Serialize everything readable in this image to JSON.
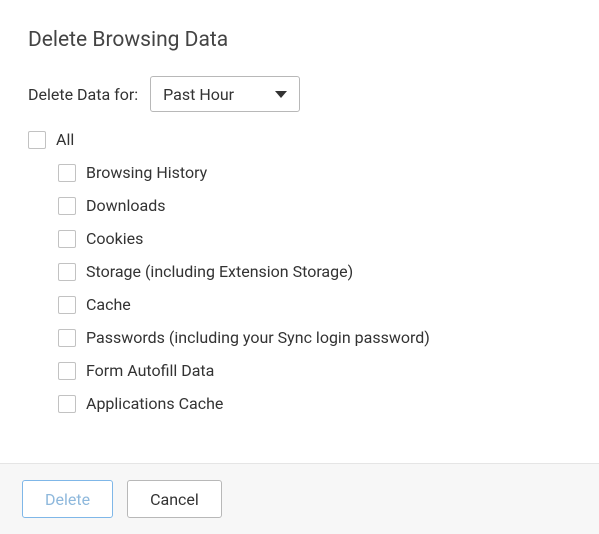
{
  "title": "Delete Browsing Data",
  "timeRange": {
    "label": "Delete Data for:",
    "selected": "Past Hour"
  },
  "allOption": {
    "label": "All",
    "checked": false
  },
  "items": [
    {
      "label": "Browsing History",
      "checked": false
    },
    {
      "label": "Downloads",
      "checked": false
    },
    {
      "label": "Cookies",
      "checked": false
    },
    {
      "label": "Storage (including Extension Storage)",
      "checked": false
    },
    {
      "label": "Cache",
      "checked": false
    },
    {
      "label": "Passwords (including your Sync login password)",
      "checked": false
    },
    {
      "label": "Form Autofill Data",
      "checked": false
    },
    {
      "label": "Applications Cache",
      "checked": false
    }
  ],
  "buttons": {
    "delete": "Delete",
    "cancel": "Cancel"
  }
}
